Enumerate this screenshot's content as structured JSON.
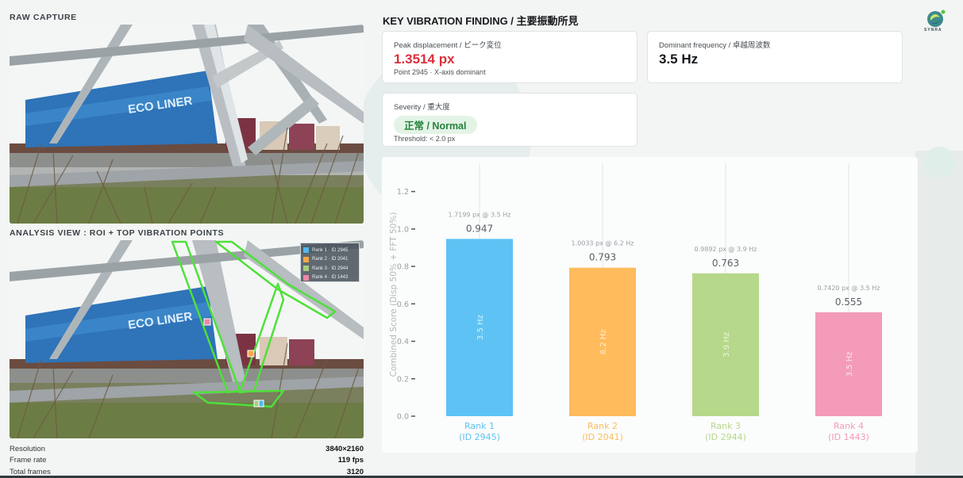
{
  "left": {
    "raw_title": "RAW CAPTURE",
    "analysis_title": "ANALYSIS VIEW : ROI + TOP VIBRATION POINTS",
    "container_text": "ECO LINER",
    "legend": [
      {
        "label": "Rank 1 · ID 2945",
        "color": "#52b8ea"
      },
      {
        "label": "Rank 2 · ID 2041",
        "color": "#f6a94a"
      },
      {
        "label": "Rank 3 · ID 2944",
        "color": "#a6cf7c"
      },
      {
        "label": "Rank 4 · ID 1443",
        "color": "#ee86a8"
      }
    ],
    "meta": [
      {
        "label": "Resolution",
        "value": "3840×2160"
      },
      {
        "label": "Frame rate",
        "value": "119 fps"
      },
      {
        "label": "Total frames",
        "value": "3120"
      }
    ]
  },
  "finding": {
    "title": "KEY VIBRATION FINDING / 主要振動所見",
    "logo_text": "SYNRA",
    "peak": {
      "label": "Peak displacement / ピーク変位",
      "value": "1.3514 px",
      "sub": "Point 2945 · X-axis dominant"
    },
    "freq": {
      "label": "Dominant frequency / 卓越周波数",
      "value": "3.5 Hz"
    },
    "severity": {
      "label": "Severity / 重大度",
      "value": "正常 / Normal",
      "sub": "Threshold: < 2.0 px"
    },
    "colors": {
      "peak": "#d9303c",
      "normal_bg": "#e3f4e6",
      "normal_text": "#26803a"
    }
  },
  "chart_data": {
    "type": "bar",
    "ylabel": "Combined Score (Disp 50% + FFT 50%)",
    "ylim": [
      0,
      1.3
    ],
    "yticks": [
      "0.0",
      "0.2",
      "0.4",
      "0.6",
      "0.8",
      "1.0",
      "1.2"
    ],
    "ytick_values": [
      0,
      0.2,
      0.4,
      0.6,
      0.8,
      1.0,
      1.2
    ],
    "categories": [
      "Rank 1",
      "Rank 2",
      "Rank 3",
      "Rank 4"
    ],
    "category_ids": [
      "(ID 2945)",
      "(ID 2041)",
      "(ID 2944)",
      "(ID 1443)"
    ],
    "values": [
      0.947,
      0.793,
      0.763,
      0.555
    ],
    "value_labels": [
      "0.947",
      "0.793",
      "0.763",
      "0.555"
    ],
    "annotations": [
      "1.7199 px @ 3.5 Hz",
      "1.0033 px @ 6.2 Hz",
      "0.9892 px @ 3.9 Hz",
      "0.7420 px @ 3.5 Hz"
    ],
    "bar_labels": [
      "3.5 Hz",
      "6.2 Hz",
      "3.9 Hz",
      "3.5 Hz"
    ],
    "colors": [
      "#5ec3f4",
      "#ffbb5c",
      "#b5d88a",
      "#f39bb8"
    ],
    "grid": "vertical"
  }
}
